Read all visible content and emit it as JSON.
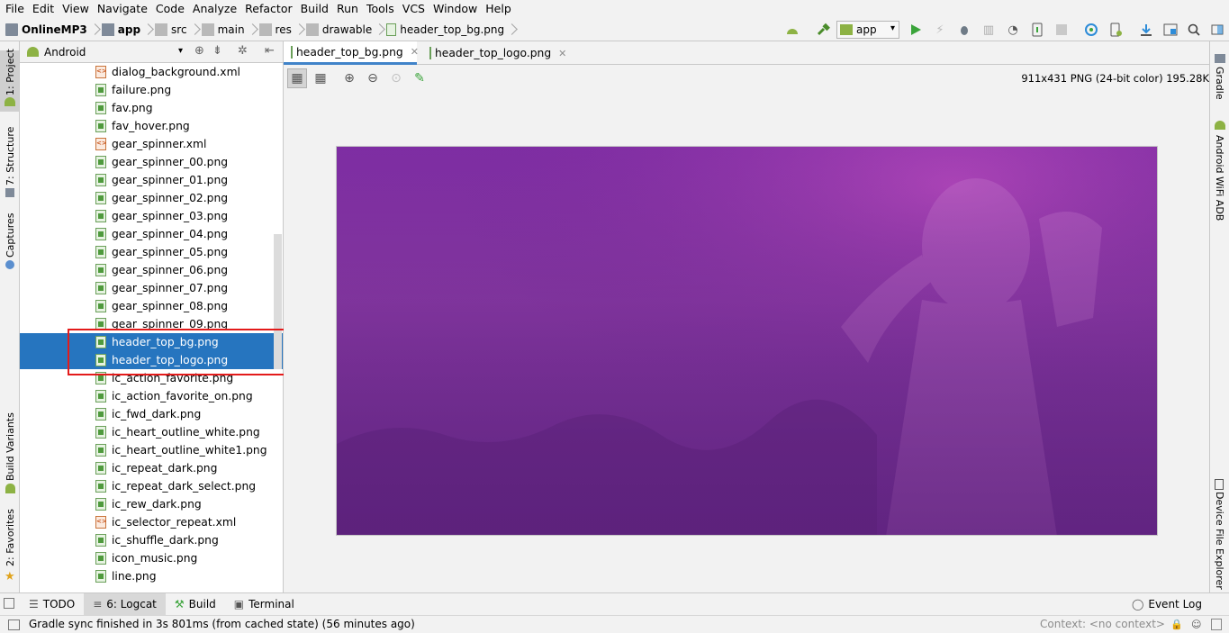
{
  "menu": [
    "File",
    "Edit",
    "View",
    "Navigate",
    "Code",
    "Analyze",
    "Refactor",
    "Build",
    "Run",
    "Tools",
    "VCS",
    "Window",
    "Help"
  ],
  "breadcrumb": [
    "OnlineMP3",
    "app",
    "src",
    "main",
    "res",
    "drawable",
    "header_top_bg.png"
  ],
  "run_config": "app",
  "left_tool_windows": [
    "1: Project",
    "7: Structure",
    "Captures",
    "Build Variants",
    "2: Favorites"
  ],
  "right_tool_windows": [
    "Gradle",
    "Android WiFi ADB",
    "Device File Explorer"
  ],
  "project_panel": {
    "view_mode": "Android",
    "files": [
      {
        "name": "dialog_background.xml",
        "type": "xml"
      },
      {
        "name": "failure.png",
        "type": "png"
      },
      {
        "name": "fav.png",
        "type": "png"
      },
      {
        "name": "fav_hover.png",
        "type": "png"
      },
      {
        "name": "gear_spinner.xml",
        "type": "xml"
      },
      {
        "name": "gear_spinner_00.png",
        "type": "png"
      },
      {
        "name": "gear_spinner_01.png",
        "type": "png"
      },
      {
        "name": "gear_spinner_02.png",
        "type": "png"
      },
      {
        "name": "gear_spinner_03.png",
        "type": "png"
      },
      {
        "name": "gear_spinner_04.png",
        "type": "png"
      },
      {
        "name": "gear_spinner_05.png",
        "type": "png"
      },
      {
        "name": "gear_spinner_06.png",
        "type": "png"
      },
      {
        "name": "gear_spinner_07.png",
        "type": "png"
      },
      {
        "name": "gear_spinner_08.png",
        "type": "png"
      },
      {
        "name": "gear_spinner_09.png",
        "type": "png"
      },
      {
        "name": "header_top_bg.png",
        "type": "png",
        "selected": true
      },
      {
        "name": "header_top_logo.png",
        "type": "png",
        "selected": true
      },
      {
        "name": "ic_action_favorite.png",
        "type": "png"
      },
      {
        "name": "ic_action_favorite_on.png",
        "type": "png"
      },
      {
        "name": "ic_fwd_dark.png",
        "type": "png"
      },
      {
        "name": "ic_heart_outline_white.png",
        "type": "png"
      },
      {
        "name": "ic_heart_outline_white1.png",
        "type": "png"
      },
      {
        "name": "ic_repeat_dark.png",
        "type": "png"
      },
      {
        "name": "ic_repeat_dark_select.png",
        "type": "png"
      },
      {
        "name": "ic_rew_dark.png",
        "type": "png"
      },
      {
        "name": "ic_selector_repeat.xml",
        "type": "xml"
      },
      {
        "name": "ic_shuffle_dark.png",
        "type": "png"
      },
      {
        "name": "icon_music.png",
        "type": "png"
      },
      {
        "name": "line.png",
        "type": "png"
      }
    ]
  },
  "editor_tabs": [
    {
      "label": "header_top_bg.png",
      "active": true
    },
    {
      "label": "header_top_logo.png",
      "active": false
    }
  ],
  "image_info": "911x431 PNG (24-bit color) 195.28K",
  "bottom_tabs": [
    {
      "label": "TODO",
      "active": false
    },
    {
      "label": "6: Logcat",
      "active": true
    },
    {
      "label": "Build",
      "active": false
    },
    {
      "label": "Terminal",
      "active": false
    }
  ],
  "event_log": "Event Log",
  "status": {
    "message": "Gradle sync finished in 3s 801ms (from cached state) (56 minutes ago)",
    "context": "Context: <no context>"
  },
  "colors": {
    "selection": "#2675bf",
    "highlight_box": "#e31b1b",
    "image_purple": "#8a3aa6"
  }
}
